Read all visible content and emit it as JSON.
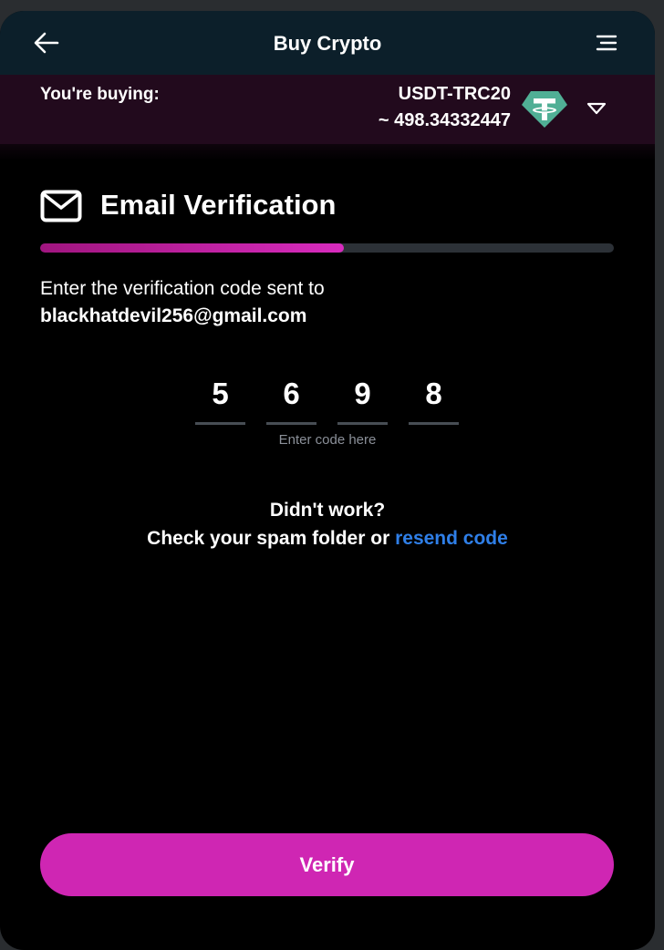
{
  "header": {
    "title": "Buy Crypto",
    "back_icon": "arrow-left-icon",
    "menu_icon": "hamburger-menu-icon"
  },
  "purchase": {
    "label": "You're buying:",
    "token": "USDT-TRC20",
    "amount": "~ 498.34332447",
    "token_icon": "tether-icon",
    "dropdown_icon": "chevron-down-icon"
  },
  "verification": {
    "icon": "mail-icon",
    "title": "Email Verification",
    "progress_percent": 53,
    "instructions": "Enter the verification code sent to",
    "email": "blackhatdevil256@gmail.com",
    "code_digits": [
      "5",
      "6",
      "9",
      "8"
    ],
    "code_hint": "Enter code here"
  },
  "help": {
    "title": "Didn't work?",
    "prefix": "Check your spam folder or",
    "resend_link": "resend code"
  },
  "actions": {
    "verify_label": "Verify"
  },
  "colors": {
    "accent": "#cf26b3",
    "header_bg": "#0c1f2a",
    "buying_bar_bg": "#220a1d",
    "link": "#2f7fe8",
    "tether": "#50af95"
  }
}
